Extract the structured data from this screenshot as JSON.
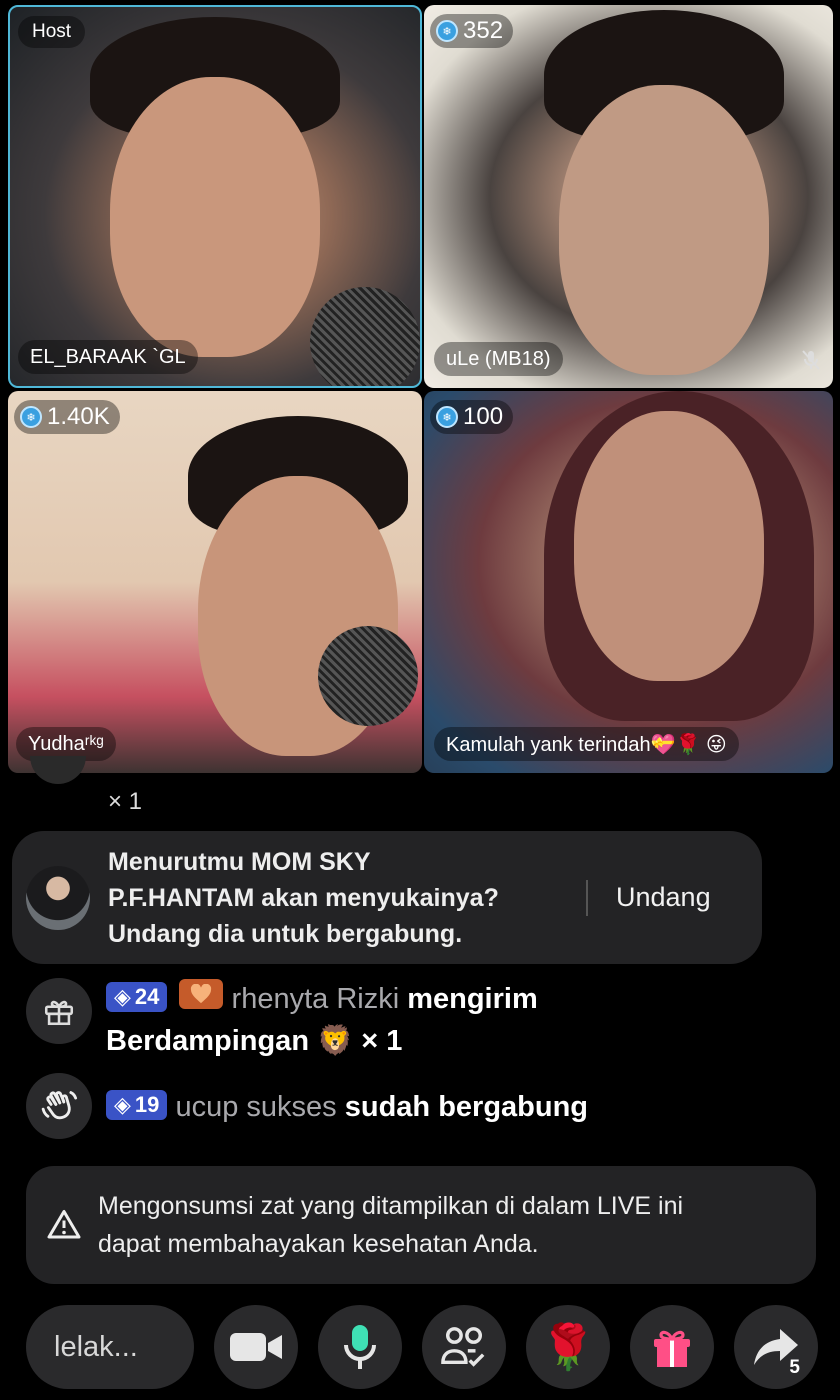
{
  "participants": [
    {
      "badge": "Host",
      "name": "EL_BARAAK `GL",
      "count": ""
    },
    {
      "badge": "",
      "count": "352",
      "name": "uLe (MB18)",
      "muted": true
    },
    {
      "badge": "",
      "count": "1.40K",
      "name": "Yudhaʳᵏᵍ"
    },
    {
      "badge": "",
      "count": "100",
      "name": "Kamulah yank terindah💝🌹 😜"
    }
  ],
  "chat": {
    "partial_line": "× 1",
    "invite": {
      "text_line1": "Menurutmu MOM SKY",
      "text_line2": "P.F.HANTAM akan menyukainya?",
      "text_line3": "Undang dia untuk bergabung.",
      "button": "Undang"
    },
    "gift_message": {
      "level": "24",
      "user": "rhenyta Rizki",
      "action": "mengirim",
      "gift_name": "Berdampingan",
      "gift_emoji": "🦁",
      "quantity": "× 1"
    },
    "join_message": {
      "level": "19",
      "user": "ucup sukses",
      "action": "sudah bergabung"
    },
    "warning": {
      "line1": "Mengonsumsi zat yang ditampilkan di dalam LIVE ini",
      "line2": "dapat membahayakan kesehatan Anda."
    }
  },
  "bottom_bar": {
    "input_placeholder": "lelak...",
    "rose_emoji": "🌹",
    "share_count": "5"
  },
  "colors": {
    "background": "#000000",
    "card": "#232325",
    "host_border": "#4fb8d8",
    "level_badge": "#3a53c6",
    "gift_pink": "#ff4f86"
  }
}
